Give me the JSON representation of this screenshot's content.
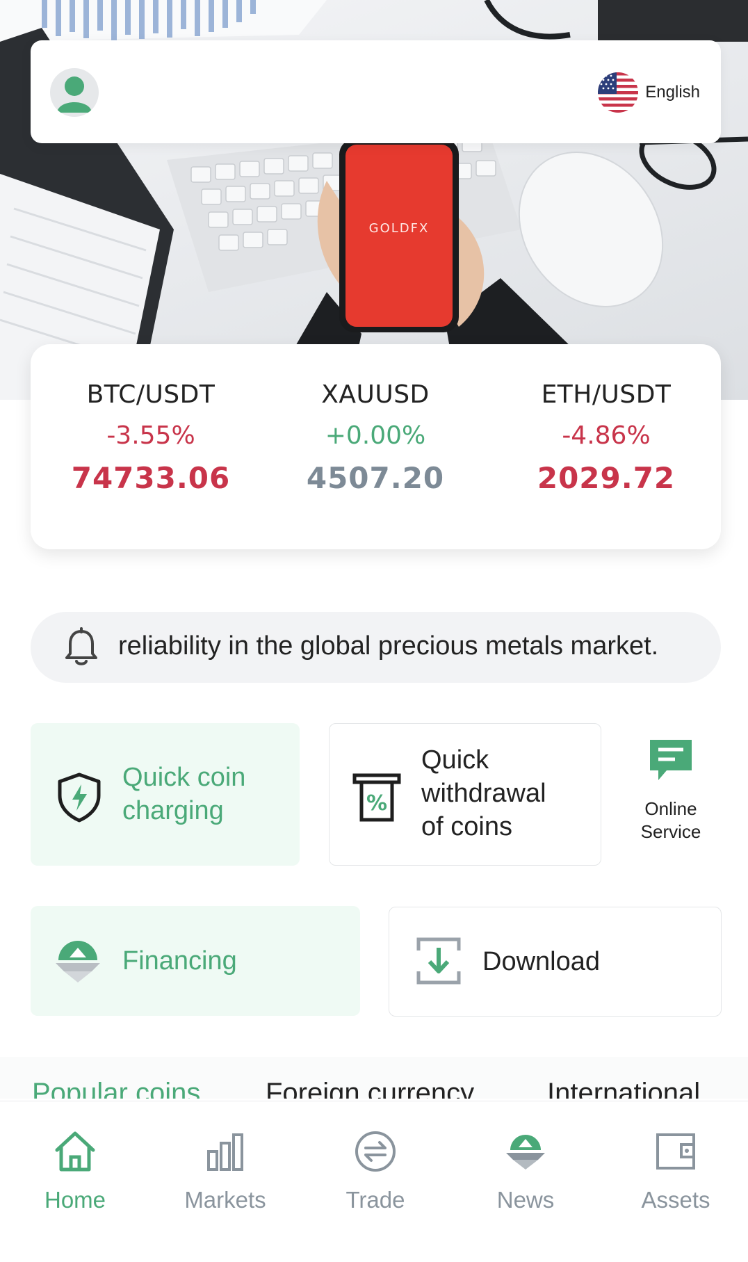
{
  "hero": {
    "phone_brand": "GOLDFX"
  },
  "header": {
    "language_label": "English",
    "language_flag_icon": "us-flag-icon",
    "avatar_icon": "user-avatar-icon"
  },
  "ticker": [
    {
      "symbol": "BTC/USDT",
      "change": "-3.55%",
      "price": "74733.06",
      "trend": "down"
    },
    {
      "symbol": "XAUUSD",
      "change": "+0.00%",
      "price": "4507.20",
      "trend": "flat"
    },
    {
      "symbol": "ETH/USDT",
      "change": "-4.86%",
      "price": "2029.72",
      "trend": "down"
    }
  ],
  "notice": {
    "icon": "bell-icon",
    "text": "reliability in the global precious metals market."
  },
  "actions": {
    "quick_charge": "Quick coin charging",
    "quick_charge_line1": "Quick coin",
    "quick_charge_line2": "charging",
    "withdraw_line1": "Quick",
    "withdraw_line2": "withdrawal",
    "withdraw_line3": "of coins",
    "online_line1": "Online",
    "online_line2": "Service",
    "financing": "Financing",
    "download": "Download"
  },
  "tabs": [
    "Popular coins",
    "Foreign currency",
    "International"
  ],
  "nav": [
    {
      "label": "Home",
      "icon": "home-icon",
      "active": true
    },
    {
      "label": "Markets",
      "icon": "bar-chart-icon",
      "active": false
    },
    {
      "label": "Trade",
      "icon": "exchange-icon",
      "active": false
    },
    {
      "label": "News",
      "icon": "news-icon",
      "active": false
    },
    {
      "label": "Assets",
      "icon": "wallet-icon",
      "active": false
    }
  ],
  "colors": {
    "accent_green": "#4aa978",
    "down_red": "#c8344a",
    "flat_gray": "#7d8a96",
    "phone_red": "#e63a2f"
  }
}
